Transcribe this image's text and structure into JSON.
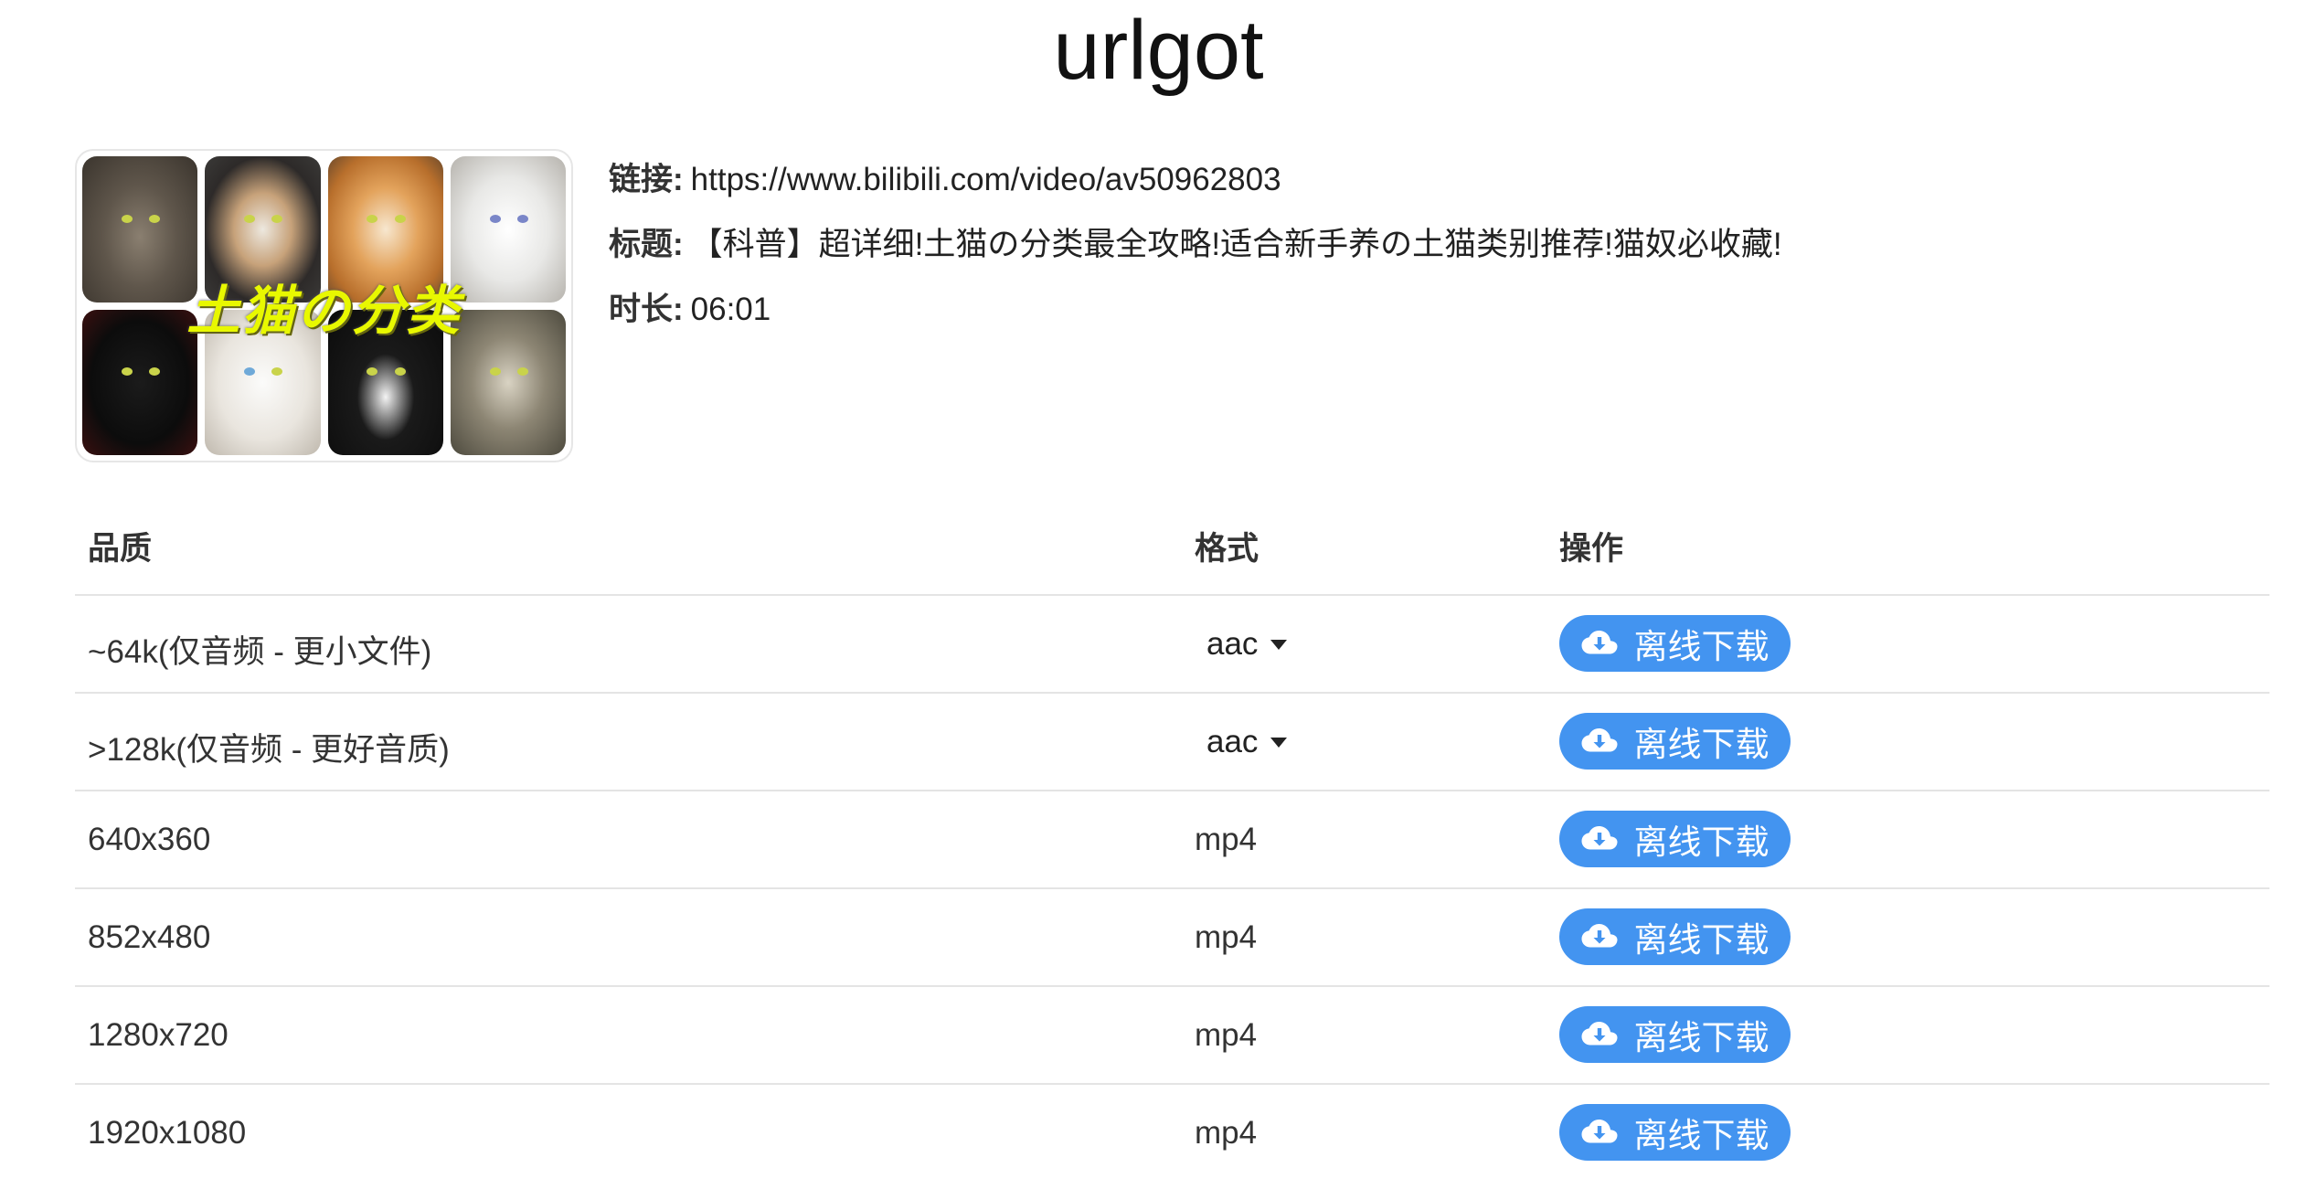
{
  "site": {
    "title": "urlgot"
  },
  "thumbnail": {
    "overlay_text": "土猫の分类"
  },
  "info": {
    "link_label": "链接:",
    "link_value": "https://www.bilibili.com/video/av50962803",
    "title_label": "标题:",
    "title_value": "【科普】超详细!土猫の分类最全攻略!适合新手养の土猫类别推荐!猫奴必收藏!",
    "duration_label": "时长:",
    "duration_value": "06:01"
  },
  "table": {
    "headers": {
      "quality": "品质",
      "format": "格式",
      "action": "操作"
    },
    "rows": [
      {
        "quality": "~64k(仅音频 - 更小文件)",
        "format": "aac",
        "format_is_select": true,
        "action": "离线下载"
      },
      {
        "quality": ">128k(仅音频 - 更好音质)",
        "format": "aac",
        "format_is_select": true,
        "action": "离线下载"
      },
      {
        "quality": "640x360",
        "format": "mp4",
        "format_is_select": false,
        "action": "离线下载"
      },
      {
        "quality": "852x480",
        "format": "mp4",
        "format_is_select": false,
        "action": "离线下载"
      },
      {
        "quality": "1280x720",
        "format": "mp4",
        "format_is_select": false,
        "action": "离线下载"
      },
      {
        "quality": "1920x1080",
        "format": "mp4",
        "format_is_select": false,
        "action": "离线下载"
      }
    ]
  },
  "colors": {
    "button": "#4394f0",
    "overlay_text": "#e8f800"
  },
  "icons": {
    "download": "cloud-download-icon",
    "dropdown": "caret-down-icon"
  }
}
